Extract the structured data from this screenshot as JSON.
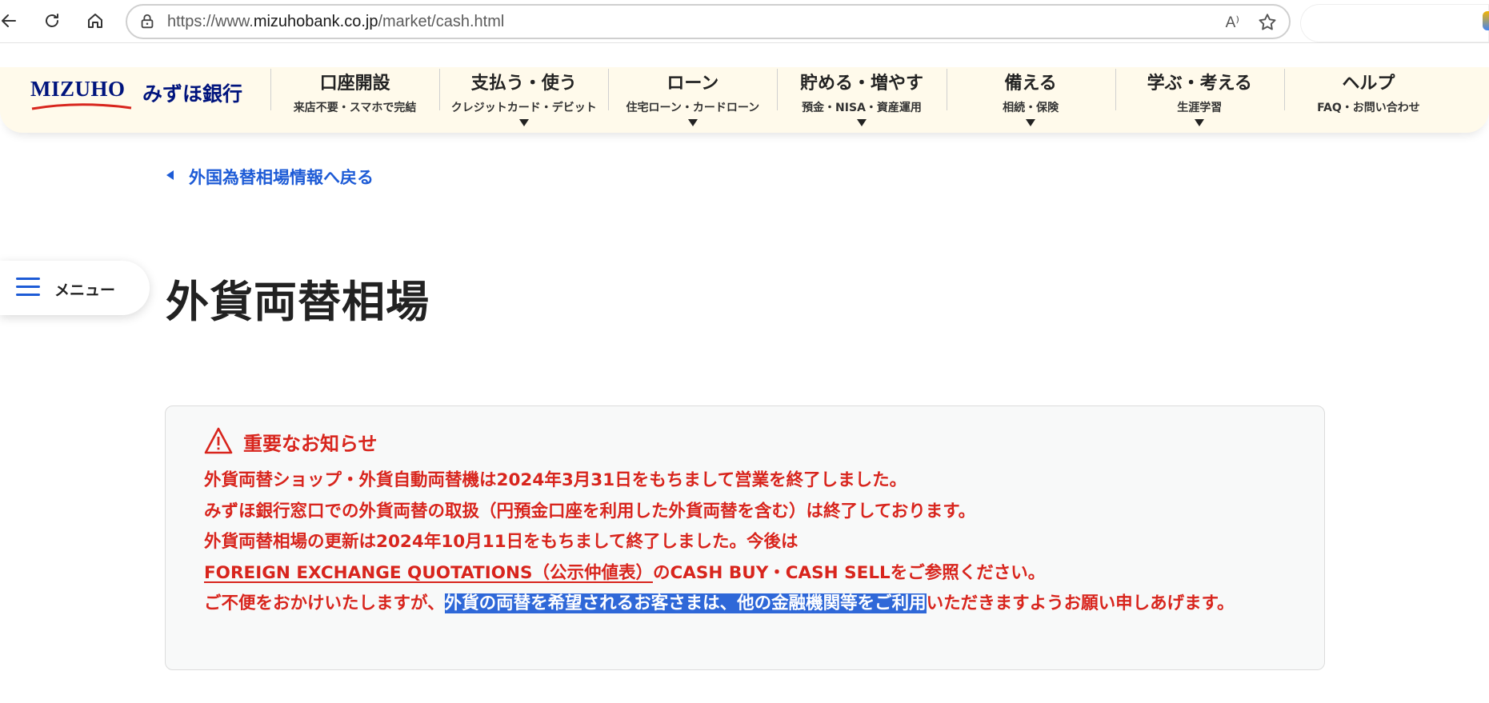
{
  "browser": {
    "url_prefix": "https://www.",
    "url_domain": "mizuhobank.co.jp",
    "url_path": "/market/cash.html",
    "read_aloud_label": "A⁾"
  },
  "header": {
    "logo_en": "MIZUHO",
    "logo_jp": "みずほ銀行",
    "brand_color": "#00147d",
    "nav": [
      {
        "title": "口座開設",
        "sub": "来店不要・スマホで完結",
        "caret": false
      },
      {
        "title": "支払う・使う",
        "sub": "クレジットカード・デビット",
        "caret": true
      },
      {
        "title": "ローン",
        "sub": "住宅ローン・カードローン",
        "caret": true
      },
      {
        "title": "貯める・増やす",
        "sub": "預金・NISA・資産運用",
        "caret": true
      },
      {
        "title": "備える",
        "sub": "相続・保険",
        "caret": true
      },
      {
        "title": "学ぶ・考える",
        "sub": "生涯学習",
        "caret": true
      },
      {
        "title": "ヘルプ",
        "sub": "FAQ・お問い合わせ",
        "caret": false
      }
    ]
  },
  "back_link": "外国為替相場情報へ戻る",
  "side_menu": {
    "label": "メニュー"
  },
  "page_title": "外貨両替相場",
  "notice": {
    "heading": "重要なお知らせ",
    "line1": "外貨両替ショップ・外貨自動両替機は2024年3月31日をもちまして営業を終了しました。",
    "line2": "みずほ銀行窓口での外貨両替の取扱（円預金口座を利用した外貨両替を含む）は終了しております。",
    "line3": "外貨両替相場の更新は2024年10月11日をもちまして終了しました。今後は",
    "line4_link": "FOREIGN EXCHANGE QUOTATIONS（公示仲値表）",
    "line4_rest": "のCASH BUY・CASH SELLをご参照ください。",
    "line5_a": "ご不便をおかけいたしますが、",
    "line5_selected": "外貨の両替を希望されるお客さまは、他の金融機関等をご利用",
    "line5_b": "いただきますようお願い申しあげます。",
    "text_color": "#d8251d"
  },
  "colors": {
    "accent_blue": "#1d5bd6",
    "header_band": "#fffaeb",
    "selection": "#2f68d8"
  }
}
